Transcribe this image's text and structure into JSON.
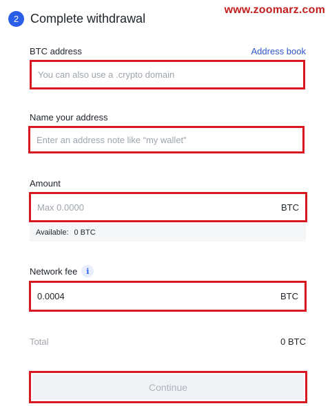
{
  "watermark": "www.zoomarz.com",
  "step": {
    "number": "2",
    "title": "Complete withdrawal"
  },
  "btc_address": {
    "label": "BTC address",
    "address_book_link": "Address book",
    "placeholder": "You can also use a .crypto domain",
    "value": ""
  },
  "address_name": {
    "label": "Name your address",
    "placeholder": "Enter an address note like “my wallet”",
    "value": ""
  },
  "amount": {
    "label": "Amount",
    "placeholder": "Max 0.0000",
    "unit": "BTC",
    "available_label": "Available:",
    "available_value": "0 BTC"
  },
  "network_fee": {
    "label": "Network fee",
    "info_glyph": "i",
    "value": "0.0004",
    "unit": "BTC"
  },
  "total": {
    "label": "Total",
    "value": "0 BTC"
  },
  "continue_button": {
    "label": "Continue",
    "enabled": false
  },
  "colors": {
    "accent": "#2a5ee8",
    "link": "#2a55c8",
    "highlight_border": "#d8181f",
    "watermark": "#c21e1e"
  }
}
